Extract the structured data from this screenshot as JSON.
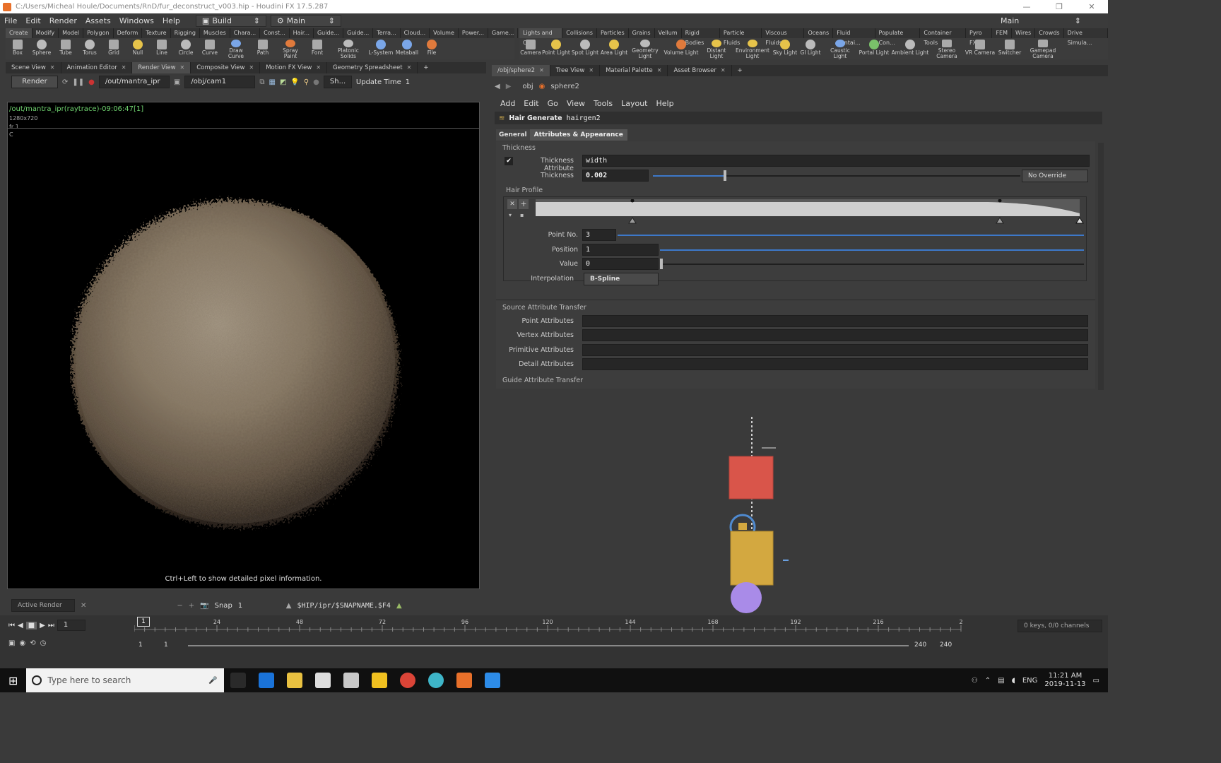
{
  "window": {
    "title": "C:/Users/Micheal Houle/Documents/RnD/fur_deconstruct_v003.hip - Houdini FX 17.5.287"
  },
  "menubar": {
    "items": [
      "File",
      "Edit",
      "Render",
      "Assets",
      "Windows",
      "Help"
    ],
    "desktop": "Build",
    "workspace": "Main",
    "right_desktop": "Main"
  },
  "shelf_left": {
    "tabs": [
      "Create",
      "Modify",
      "Model",
      "Polygon",
      "Deform",
      "Texture",
      "Rigging",
      "Muscles",
      "Chara...",
      "Const...",
      "Hair...",
      "Guide...",
      "Guide...",
      "Terra...",
      "Cloud...",
      "Volume",
      "Power...",
      "Game..."
    ],
    "tools": [
      "Box",
      "Sphere",
      "Tube",
      "Torus",
      "Grid",
      "Null",
      "Line",
      "Circle",
      "Curve",
      "Draw Curve",
      "Path",
      "Spray Paint",
      "Font",
      "Platonic Solids",
      "L-System",
      "Metaball",
      "File"
    ]
  },
  "shelf_right": {
    "tabs": [
      "Lights and C...",
      "Collisions",
      "Particles",
      "Grains",
      "Vellum",
      "Rigid Bodies",
      "Particle Fluids",
      "Viscous Fluids",
      "Oceans",
      "Fluid Contai...",
      "Populate Con...",
      "Container Tools",
      "Pyro FX",
      "FEM",
      "Wires",
      "Crowds",
      "Drive Simula..."
    ],
    "tools": [
      "Camera",
      "Point Light",
      "Spot Light",
      "Area Light",
      "Geometry Light",
      "Volume Light",
      "Distant Light",
      "Environment Light",
      "Sky Light",
      "GI Light",
      "Caustic Light",
      "Portal Light",
      "Ambient Light",
      "Stereo Camera",
      "VR Camera",
      "Switcher",
      "Gamepad Camera"
    ]
  },
  "left_panel": {
    "tabs": [
      "Scene View",
      "Animation Editor",
      "Render View",
      "Composite View",
      "Motion FX View",
      "Geometry Spreadsheet"
    ],
    "render_button": "Render",
    "output_driver": "/out/mantra_ipr",
    "camera": "/obj/cam1",
    "shading": "Sh...",
    "update_time_label": "Update Time",
    "update_time_value": "1",
    "render_path": "/out/mantra_ipr(raytrace)-09:06:47[1]",
    "resolution": "1280x720",
    "frame": "fr 1",
    "channel": "C",
    "hint": "Ctrl+Left to show detailed pixel information.",
    "active_render": "Active Render",
    "snap_label": "Snap",
    "snap_value": "1",
    "snap_path": "$HIP/ipr/$SNAPNAME.$F4"
  },
  "right_panel": {
    "tabs": [
      "/obj/sphere2",
      "Tree View",
      "Material Palette",
      "Asset Browser"
    ],
    "path": [
      "obj",
      "sphere2"
    ],
    "menu": [
      "Add",
      "Edit",
      "Go",
      "View",
      "Tools",
      "Layout",
      "Help"
    ],
    "node_type": "Hair Generate",
    "node_name": "hairgen2",
    "param_tabs": [
      "General",
      "Attributes & Appearance"
    ],
    "thickness_section": "Thickness",
    "thickness_attr_label": "Thickness Attribute",
    "thickness_attr_value": "width",
    "thickness_label": "Thickness",
    "thickness_value": "0.002",
    "thickness_override": "No Override",
    "hair_profile": "Hair Profile",
    "point_no_label": "Point No.",
    "point_no_value": "3",
    "position_label": "Position",
    "position_value": "1",
    "value_label": "Value",
    "value_value": "0",
    "interp_label": "Interpolation",
    "interp_value": "B-Spline",
    "source_section": "Source Attribute Transfer",
    "point_attrs": "Point Attributes",
    "vertex_attrs": "Vertex Attributes",
    "prim_attrs": "Primitive Attributes",
    "detail_attrs": "Detail Attributes",
    "guide_section": "Guide Attribute Transfer"
  },
  "timeline": {
    "frame": "1",
    "ticks": [
      "1",
      "24",
      "48",
      "72",
      "96",
      "120",
      "144",
      "168",
      "192",
      "216",
      "2"
    ],
    "range_start": "1",
    "range_start2": "1",
    "range_end": "240",
    "range_end2": "240",
    "keys": "0 keys, 0/0 channels"
  },
  "taskbar": {
    "search_placeholder": "Type here to search",
    "lang": "ENG",
    "time": "11:21 AM",
    "date": "2019-11-13"
  },
  "colors": {
    "node_red": "#d9554a",
    "node_yellow": "#d3a840",
    "node_purple": "#a98be8",
    "accent_blue": "#3d78c9"
  }
}
